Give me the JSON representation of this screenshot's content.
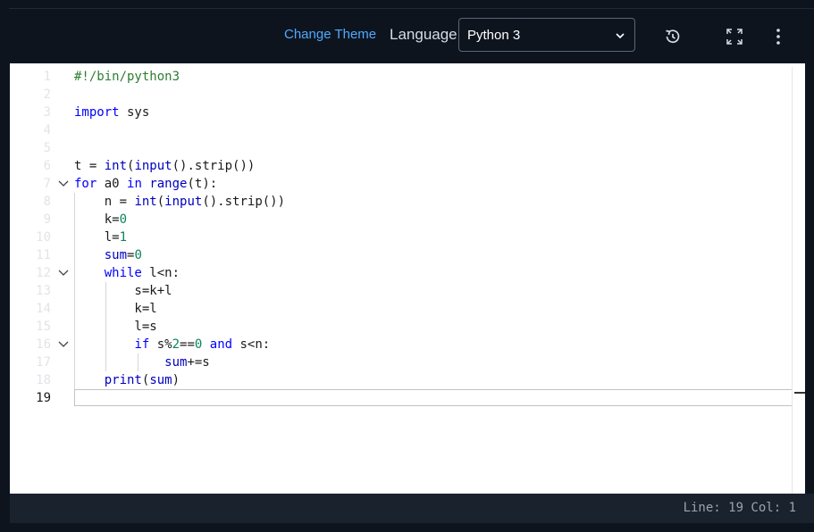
{
  "toolbar": {
    "change_theme_label": "Change Theme",
    "language_label": "Language",
    "language_value": "Python 3",
    "icons": [
      "restore-icon",
      "fullscreen-icon",
      "more-vertical-icon"
    ]
  },
  "editor": {
    "line_numbers": [
      "1",
      "2",
      "3",
      "4",
      "5",
      "6",
      "7",
      "8",
      "9",
      "10",
      "11",
      "12",
      "13",
      "14",
      "15",
      "16",
      "17",
      "18",
      "19"
    ],
    "active_line": "19",
    "code": {
      "l1": "#!/bin/python3",
      "l3_kw": "import",
      "l3_rest": " sys",
      "l6_a": "t = ",
      "l6_b": "int",
      "l6_c": "(",
      "l6_d": "input",
      "l6_e": "().strip())",
      "l7_a": "for",
      "l7_b": " a0 ",
      "l7_c": "in",
      "l7_d": " ",
      "l7_e": "range",
      "l7_f": "(t):",
      "l8_a": "    n = ",
      "l8_b": "int",
      "l8_c": "(",
      "l8_d": "input",
      "l8_e": "().strip())",
      "l9_a": "    k=",
      "l9_b": "0",
      "l10_a": "    l=",
      "l10_b": "1",
      "l11_a": "    ",
      "l11_b": "sum",
      "l11_c": "=",
      "l11_d": "0",
      "l12_a": "    ",
      "l12_b": "while",
      "l12_c": " l<n:",
      "l13": "        s=k+l",
      "l14": "        k=l",
      "l15": "        l=s",
      "l16_a": "        ",
      "l16_b": "if",
      "l16_c": " s%",
      "l16_d": "2",
      "l16_e": "==",
      "l16_f": "0",
      "l16_g": " ",
      "l16_h": "and",
      "l16_i": " s<n:",
      "l17_a": "            ",
      "l17_b": "sum",
      "l17_c": "+=s",
      "l18_a": "    ",
      "l18_b": "print",
      "l18_c": "(",
      "l18_d": "sum",
      "l18_e": ")"
    }
  },
  "status": {
    "text": "Line: 19 Col: 1"
  },
  "colors": {
    "accent": "#4fa9ff",
    "background": "#0e141e",
    "keyword": "#0000ff",
    "number": "#098658",
    "comment": "#2e7d32"
  }
}
